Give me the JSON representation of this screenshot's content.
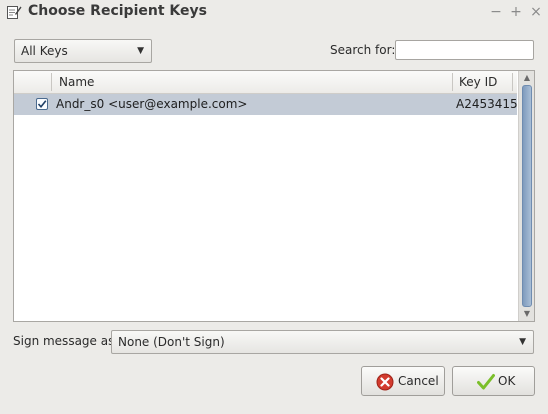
{
  "window": {
    "title": "Choose Recipient Keys",
    "minimize": "−",
    "maximize": "+",
    "close": "×"
  },
  "filter": {
    "selected": "All Keys"
  },
  "search": {
    "label": "Search for:",
    "value": ""
  },
  "table": {
    "columns": [
      "",
      "Name",
      "Key ID"
    ],
    "rows": [
      {
        "checked": true,
        "name": "Andr_s0 <user@example.com>",
        "key_id": "A2453415"
      }
    ]
  },
  "sign": {
    "label": "Sign message as:",
    "selected": "None (Don't Sign)"
  },
  "buttons": {
    "cancel": "Cancel",
    "ok": "OK"
  },
  "colors": {
    "selection": "#c3cbd6",
    "scroll_thumb": "#8fa8c8",
    "cancel_icon": "#d23b2e",
    "ok_icon": "#7bbf2a"
  }
}
